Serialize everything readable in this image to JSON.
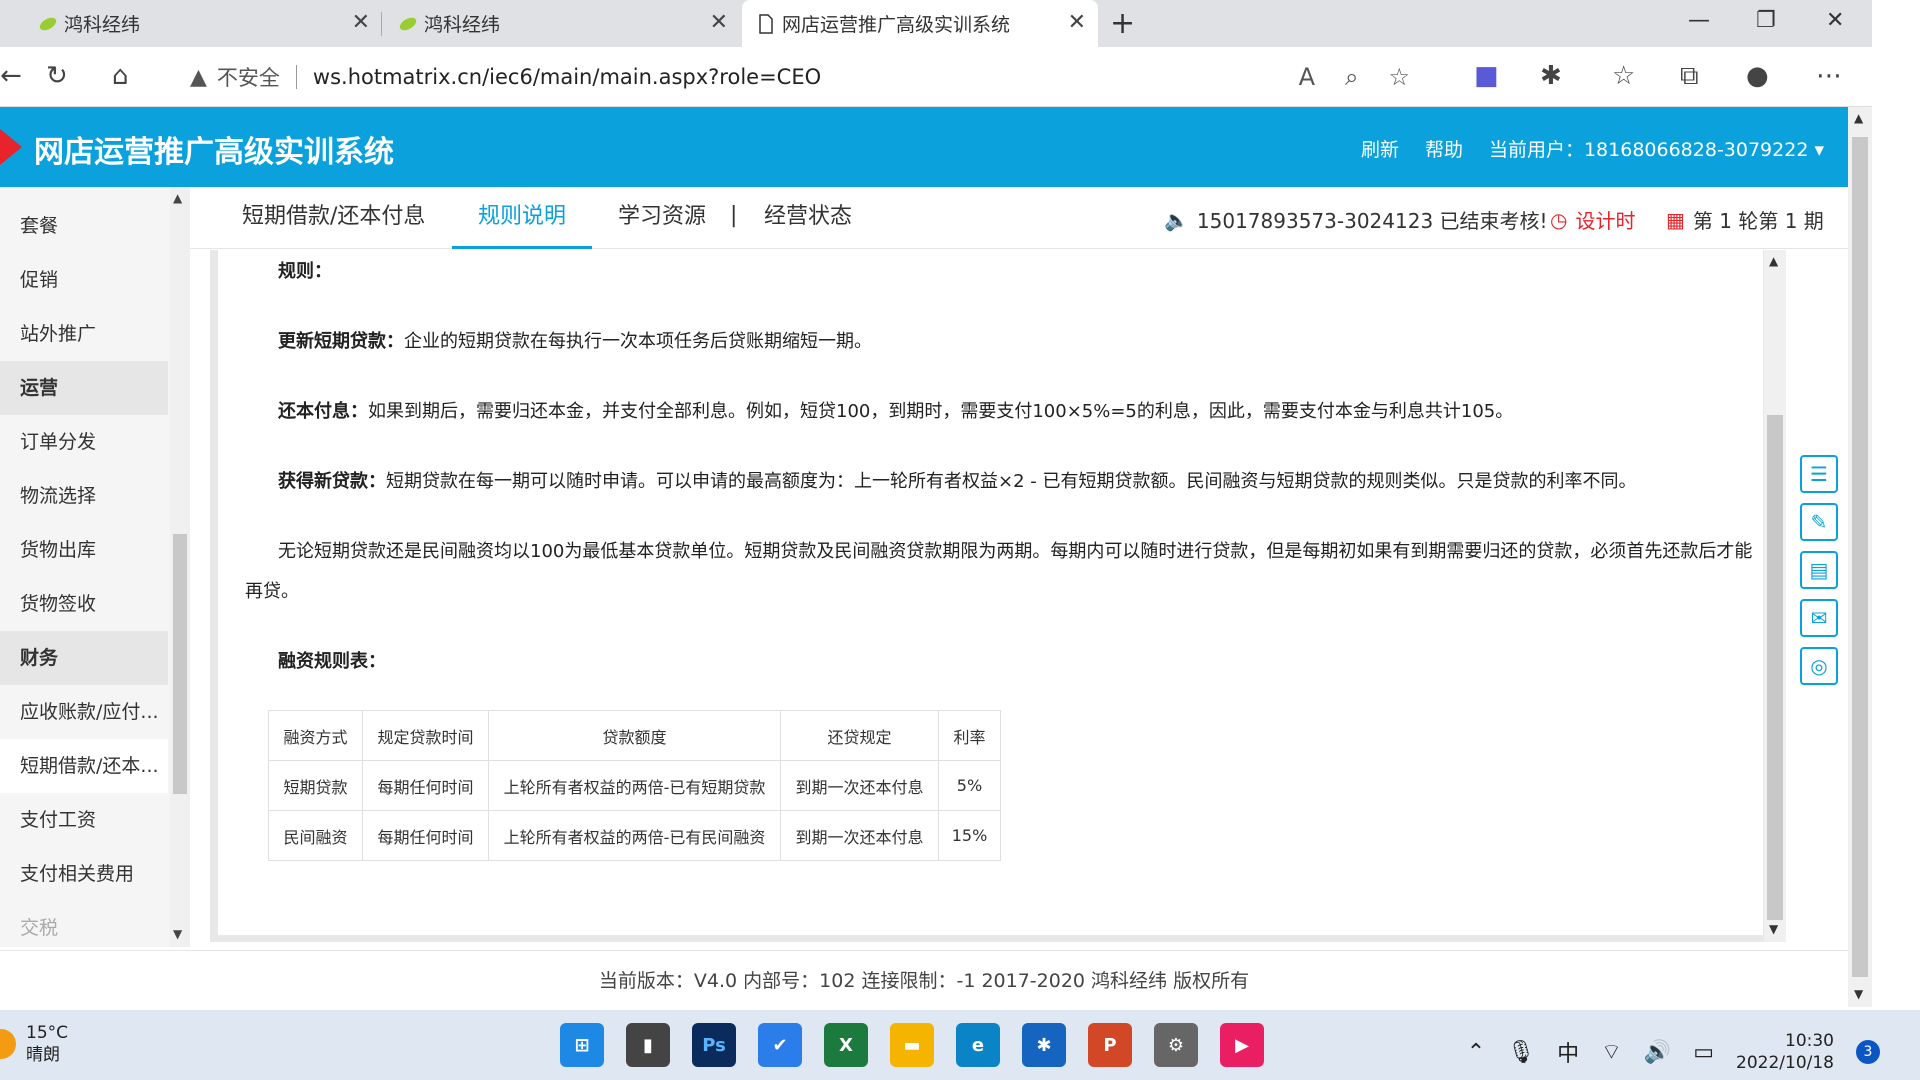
{
  "browser": {
    "tabs": [
      {
        "title": "鸿科经纬"
      },
      {
        "title": "鸿科经纬"
      },
      {
        "title": "网店运营推广高级实训系统"
      }
    ],
    "insecure_label": "不安全",
    "url": "ws.hotmatrix.cn/iec6/main/main.aspx?role=CEO"
  },
  "app": {
    "title": "网店运营推广高级实训系统",
    "refresh": "刷新",
    "help": "帮助",
    "current_user": "当前用户：18168066828-3079222"
  },
  "nav": {
    "items": [
      {
        "label": "套餐",
        "kind": "item"
      },
      {
        "label": "促销",
        "kind": "item"
      },
      {
        "label": "站外推广",
        "kind": "item"
      },
      {
        "label": "运营",
        "kind": "group"
      },
      {
        "label": "订单分发",
        "kind": "item"
      },
      {
        "label": "物流选择",
        "kind": "item"
      },
      {
        "label": "货物出库",
        "kind": "item"
      },
      {
        "label": "货物签收",
        "kind": "item"
      },
      {
        "label": "财务",
        "kind": "group"
      },
      {
        "label": "应收账款/应付...",
        "kind": "item"
      },
      {
        "label": "短期借款/还本...",
        "kind": "active"
      },
      {
        "label": "支付工资",
        "kind": "item"
      },
      {
        "label": "支付相关费用",
        "kind": "item"
      },
      {
        "label": "交税",
        "kind": "disabled"
      }
    ]
  },
  "topnav": {
    "tab1": "短期借款/还本付息",
    "tab2": "规则说明",
    "tab3": "学习资源",
    "sep": "|",
    "tab4": "经营状态",
    "notice": "15017893573-3024123 已结束考核!",
    "design": "设计时",
    "period": "第 1 轮第 1 期"
  },
  "content": {
    "rules_heading": "规则：",
    "p1_label": "更新短期贷款：",
    "p1_text": "企业的短期贷款在每执行一次本项任务后贷账期缩短一期。",
    "p2_label": "还本付息：",
    "p2_text": "如果到期后，需要归还本金，并支付全部利息。例如，短贷100，到期时，需要支付100×5%=5的利息，因此，需要支付本金与利息共计105。",
    "p3_label": "获得新贷款：",
    "p3_text": "短期贷款在每一期可以随时申请。可以申请的最高额度为：上一轮所有者权益×2 - 已有短期贷款额。民间融资与短期贷款的规则类似。只是贷款的利率不同。",
    "p4_text": "无论短期贷款还是民间融资均以100为最低基本贷款单位。短期贷款及民间融资贷款期限为两期。每期内可以随时进行贷款，但是每期初如果有到期需要归还的贷款，必须首先还款后才能再贷。",
    "table_heading": "融资规则表："
  },
  "table": {
    "headers": [
      "融资方式",
      "规定贷款时间",
      "贷款额度",
      "还贷规定",
      "利率"
    ],
    "rows": [
      [
        "短期贷款",
        "每期任何时间",
        "上轮所有者权益的两倍-已有短期贷款",
        "到期一次还本付息",
        "5%"
      ],
      [
        "民间融资",
        "每期任何时间",
        "上轮所有者权益的两倍-已有民间融资",
        "到期一次还本付息",
        "15%"
      ]
    ]
  },
  "footer": {
    "text": "当前版本：V4.0 内部号：102 连接限制：-1 2017-2020 鸿科经纬 版权所有"
  },
  "taskbar": {
    "temp": "15°C",
    "weather": "晴朗",
    "ime": "中",
    "time": "10:30",
    "date": "2022/10/18",
    "notifications": "3"
  },
  "colors": {
    "accent": "#0aa1dc",
    "logo_red": "#e8232b"
  }
}
